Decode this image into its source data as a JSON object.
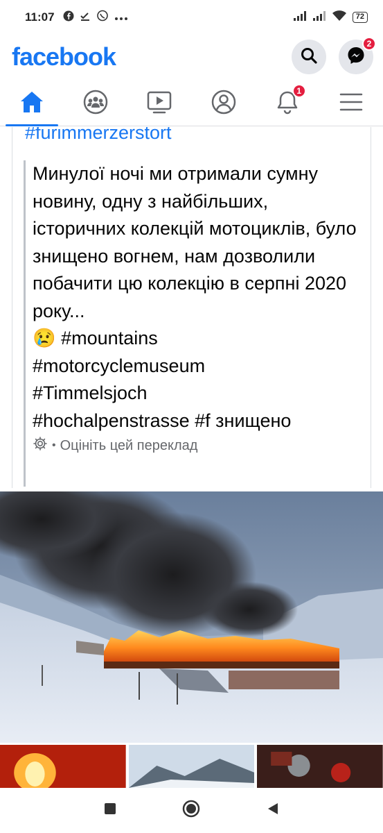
{
  "status_bar": {
    "time": "11:07",
    "battery": "72",
    "left_icons": [
      "facebook-icon",
      "download-check-icon",
      "viber-icon",
      "more-dots-icon"
    ],
    "right_icons": [
      "signal-icon",
      "signal-icon-2",
      "wifi-icon",
      "battery-icon"
    ]
  },
  "header": {
    "logo": "facebook",
    "messenger_badge": "2"
  },
  "tabs": [
    {
      "name": "home",
      "icon": "home-icon",
      "active": true
    },
    {
      "name": "groups",
      "icon": "groups-icon",
      "active": false
    },
    {
      "name": "watch",
      "icon": "video-icon",
      "active": false
    },
    {
      "name": "profile",
      "icon": "profile-icon",
      "active": false
    },
    {
      "name": "notifications",
      "icon": "bell-icon",
      "active": false,
      "badge": "1"
    },
    {
      "name": "menu",
      "icon": "menu-icon",
      "active": false
    }
  ],
  "post": {
    "hashtag_top": "#furimmerzerstort",
    "translated_text": "Минулої ночі ми отримали сумну новину, одну з найбільших, історичних колекцій мотоциклів, було знищено вогнем, нам дозволили побачити цю колекцію в серпні 2020 року...",
    "emoji": "😢",
    "tags_line1": "#mountains",
    "tags_line2": "#motorcyclemuseum",
    "tags_line3": "#Timmelsjoch",
    "tags_line4": "#hochalpenstrasse #f знищено",
    "translate_dot": "•",
    "rate_translation": "Оцініть цей переклад"
  },
  "colors": {
    "brand": "#1877f2",
    "badge": "#e41e3f",
    "muted": "#65676b"
  }
}
